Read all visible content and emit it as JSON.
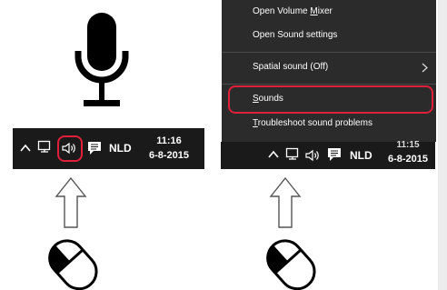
{
  "colors": {
    "highlight": "#e0203a",
    "taskbar": "#1a1a1a",
    "menu": "#2b2b2b"
  },
  "left_taskbar": {
    "language": "NLD",
    "time": "11:16",
    "date": "6-8-2015"
  },
  "right_taskbar": {
    "language": "NLD",
    "time": "11:15",
    "date": "6-8-2015"
  },
  "context_menu": {
    "items": [
      {
        "pre": "Open Volume ",
        "accel": "M",
        "post": "ixer"
      },
      {
        "pre": "Open Sound settings",
        "accel": "",
        "post": ""
      },
      {
        "pre": "Spatial sound (Off)",
        "accel": "",
        "post": ""
      },
      {
        "pre": "",
        "accel": "S",
        "post": "ounds"
      },
      {
        "pre": "",
        "accel": "T",
        "post": "roubleshoot sound problems"
      }
    ]
  },
  "icons": {
    "microphone": "microphone-icon",
    "speaker": "speaker-icon",
    "arrow": "up-arrow-icon",
    "mouse": "mouse-left-click-icon",
    "chevron": "chevron-up-icon",
    "network": "network-icon",
    "action_center": "action-center-icon",
    "submenu": "chevron-right-icon"
  }
}
